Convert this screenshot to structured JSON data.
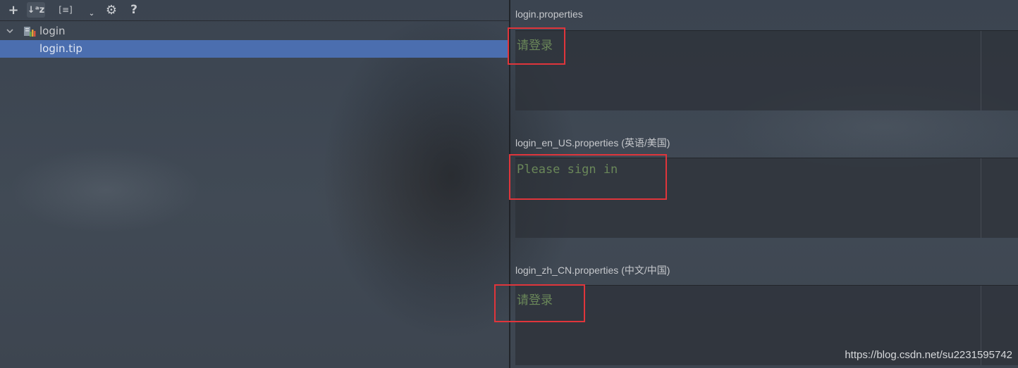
{
  "toolbar": {
    "buttons": [
      {
        "name": "add",
        "glyph": "+"
      },
      {
        "name": "sort-alphabetically",
        "glyph": "↓ᵃz"
      },
      {
        "name": "group-properties",
        "glyph": "[≡]"
      },
      {
        "name": "more-dropdown",
        "glyph": "⌄"
      },
      {
        "name": "settings",
        "glyph": "⚙"
      },
      {
        "name": "help",
        "glyph": "?"
      }
    ]
  },
  "tree": {
    "root": {
      "label": "login",
      "icon": "resource-bundle-icon",
      "expanded": true
    },
    "items": [
      {
        "label": "login.tip",
        "selected": true
      }
    ]
  },
  "editors": [
    {
      "title": "login.properties",
      "value": "请登录"
    },
    {
      "title": "login_en_US.properties (英语/美国)",
      "value": "Please sign in"
    },
    {
      "title": "login_zh_CN.properties (中文/中国)",
      "value": "请登录"
    }
  ],
  "colors": {
    "selection": "#4b6eaf",
    "string_value": "#6a8759",
    "highlight_border": "#e0353b"
  },
  "watermark": "https://blog.csdn.net/su2231595742"
}
